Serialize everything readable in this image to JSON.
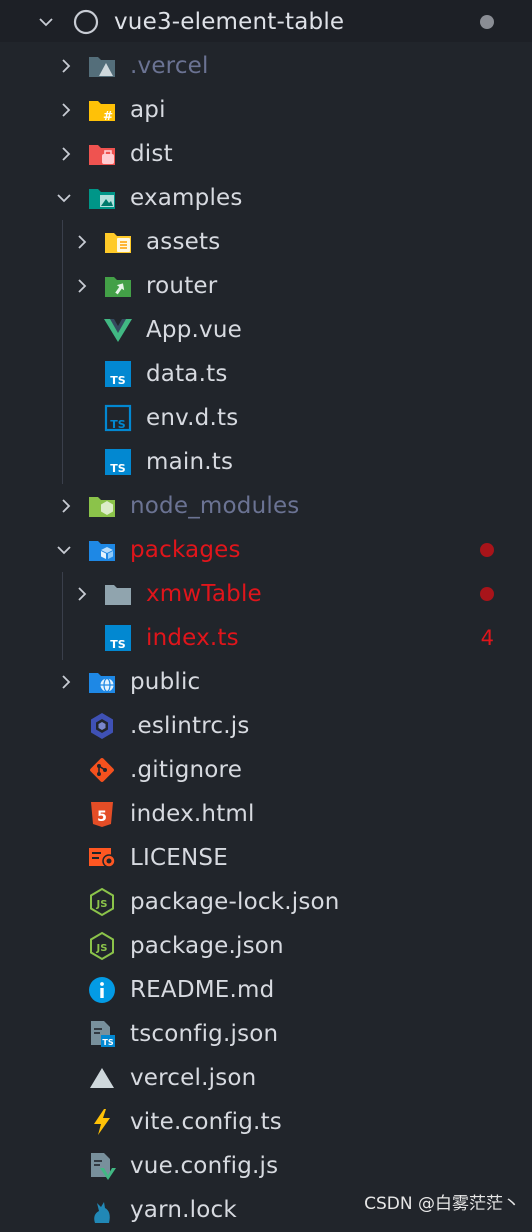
{
  "explorer": {
    "root": {
      "name": "vue3-element-table",
      "status_dot_color": "#8a8d94"
    },
    "items": [
      {
        "name": ".vercel",
        "kind": "folder",
        "icon": "vercel-folder-icon",
        "expanded": false,
        "style": "dim"
      },
      {
        "name": "api",
        "kind": "folder",
        "icon": "api-folder-icon",
        "expanded": false
      },
      {
        "name": "dist",
        "kind": "folder",
        "icon": "dist-folder-icon",
        "expanded": false
      },
      {
        "name": "examples",
        "kind": "folder",
        "icon": "examples-folder-icon",
        "expanded": true
      },
      {
        "name": "assets",
        "kind": "folder",
        "icon": "assets-folder-icon",
        "expanded": false
      },
      {
        "name": "router",
        "kind": "folder",
        "icon": "router-folder-icon",
        "expanded": false
      },
      {
        "name": "App.vue",
        "kind": "file",
        "icon": "vue-file-icon"
      },
      {
        "name": "data.ts",
        "kind": "file",
        "icon": "ts-file-icon"
      },
      {
        "name": "env.d.ts",
        "kind": "file",
        "icon": "ts-declaration-file-icon"
      },
      {
        "name": "main.ts",
        "kind": "file",
        "icon": "ts-file-icon"
      },
      {
        "name": "node_modules",
        "kind": "folder",
        "icon": "node-modules-folder-icon",
        "expanded": false,
        "style": "dim"
      },
      {
        "name": "packages",
        "kind": "folder",
        "icon": "packages-folder-icon",
        "expanded": true,
        "style": "error",
        "badge": "dot"
      },
      {
        "name": "xmwTable",
        "kind": "folder",
        "icon": "plain-folder-icon",
        "expanded": false,
        "style": "error",
        "badge": "dot"
      },
      {
        "name": "index.ts",
        "kind": "file",
        "icon": "ts-file-icon",
        "style": "error",
        "badge": "4"
      },
      {
        "name": "public",
        "kind": "folder",
        "icon": "public-folder-icon",
        "expanded": false
      },
      {
        "name": ".eslintrc.js",
        "kind": "file",
        "icon": "eslint-icon"
      },
      {
        "name": ".gitignore",
        "kind": "file",
        "icon": "git-icon"
      },
      {
        "name": "index.html",
        "kind": "file",
        "icon": "html5-icon"
      },
      {
        "name": "LICENSE",
        "kind": "file",
        "icon": "license-icon"
      },
      {
        "name": "package-lock.json",
        "kind": "file",
        "icon": "nodejs-icon"
      },
      {
        "name": "package.json",
        "kind": "file",
        "icon": "nodejs-icon"
      },
      {
        "name": "README.md",
        "kind": "file",
        "icon": "info-icon"
      },
      {
        "name": "tsconfig.json",
        "kind": "file",
        "icon": "tsconfig-icon"
      },
      {
        "name": "vercel.json",
        "kind": "file",
        "icon": "vercel-triangle-icon"
      },
      {
        "name": "vite.config.ts",
        "kind": "file",
        "icon": "vite-lightning-icon"
      },
      {
        "name": "vue.config.js",
        "kind": "file",
        "icon": "vue-config-icon"
      },
      {
        "name": "yarn.lock",
        "kind": "file",
        "icon": "yarn-cat-icon"
      }
    ]
  },
  "colors": {
    "background": "#21252b",
    "text": "#d7dae0",
    "dim_text": "#6b7393",
    "error": "#e0151b",
    "error_dot": "#a8141a"
  },
  "watermark": "CSDN @白雾茫茫丶"
}
